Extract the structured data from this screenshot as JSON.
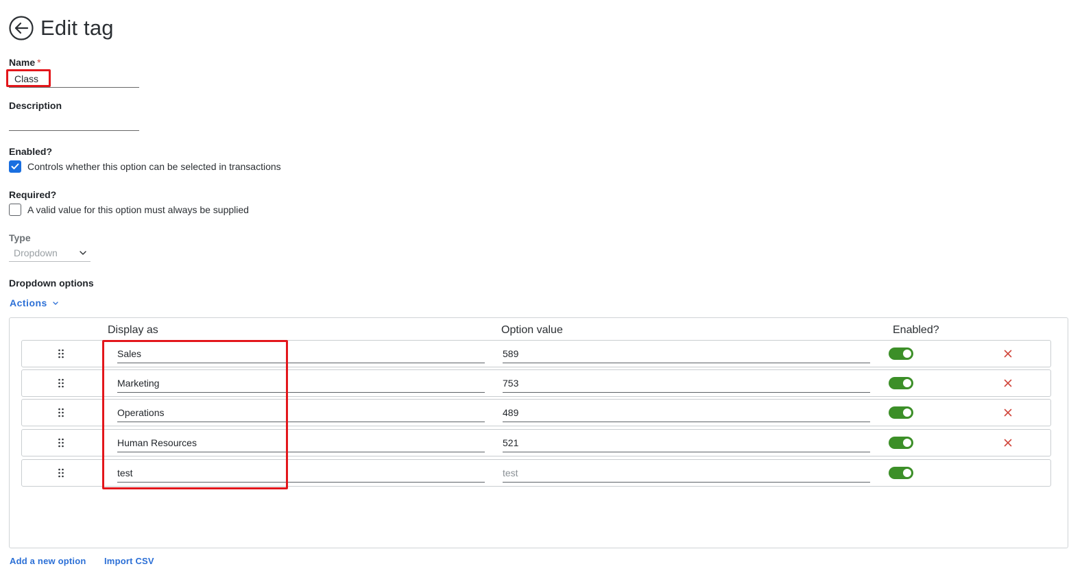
{
  "header": {
    "title": "Edit tag"
  },
  "name_field": {
    "label": "Name",
    "required_marker": "*",
    "value": "Class"
  },
  "description_field": {
    "label": "Description",
    "value": ""
  },
  "enabled": {
    "label": "Enabled?",
    "checkbox_text": "Controls whether this option can be selected in transactions",
    "checked": true
  },
  "required": {
    "label": "Required?",
    "checkbox_text": "A valid value for this option must always be supplied",
    "checked": false
  },
  "type": {
    "label": "Type",
    "selected": "Dropdown"
  },
  "dropdown_options": {
    "heading": "Dropdown options",
    "actions_label": "Actions",
    "columns": {
      "display": "Display as",
      "value": "Option value",
      "enabled": "Enabled?"
    },
    "rows": [
      {
        "display": "Sales",
        "value": "589",
        "enabled": true,
        "deletable": true
      },
      {
        "display": "Marketing",
        "value": "753",
        "enabled": true,
        "deletable": true
      },
      {
        "display": "Operations",
        "value": "489",
        "enabled": true,
        "deletable": true
      },
      {
        "display": "Human Resources",
        "value": "521",
        "enabled": true,
        "deletable": true
      },
      {
        "display": "test",
        "value_placeholder": "test",
        "enabled": true,
        "deletable": false
      }
    ]
  },
  "footer": {
    "add_option": "Add a new option",
    "import_csv": "Import CSV"
  },
  "colors": {
    "accent": "#2b6fd6",
    "toggle_on": "#3c8f28",
    "delete": "#d0453a",
    "highlight": "#e3161b",
    "checkbox": "#1a6fe0"
  }
}
